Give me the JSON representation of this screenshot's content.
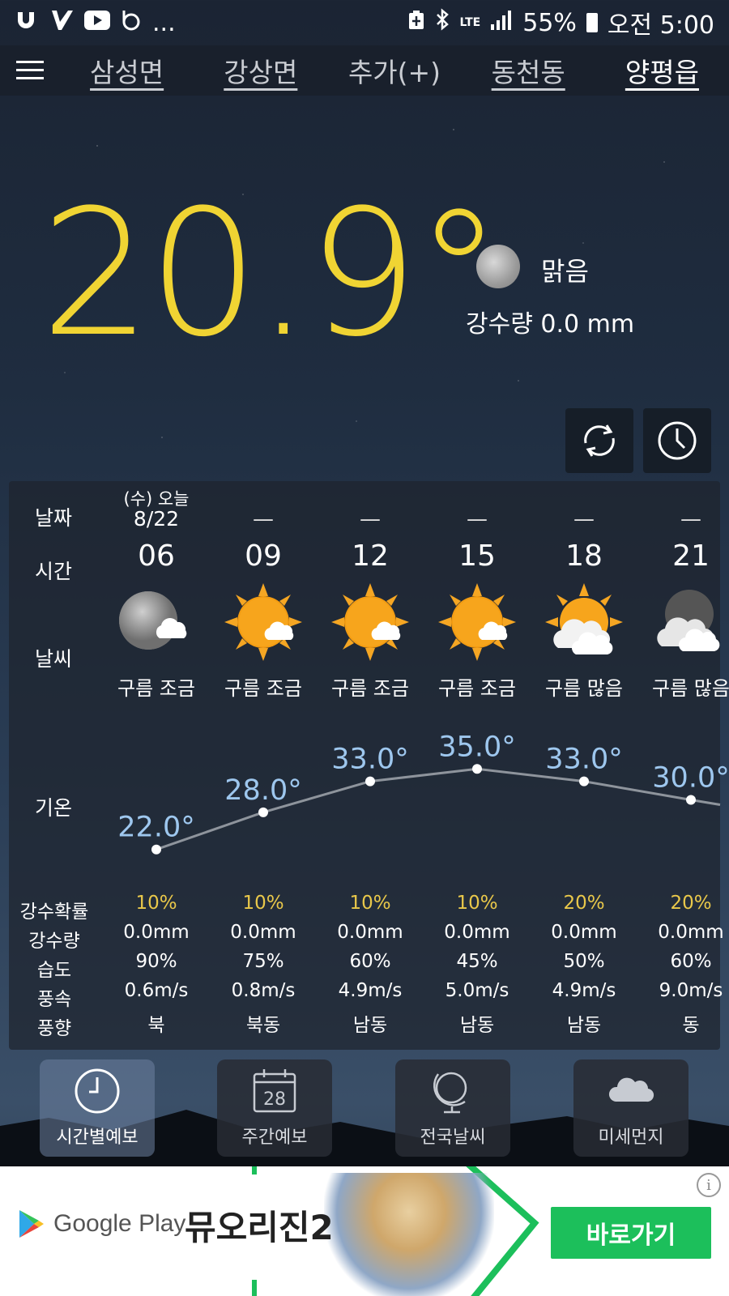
{
  "status_bar": {
    "left_icons": [
      "ubiquiti-icon",
      "vm-icon",
      "youtube-icon",
      "b-icon"
    ],
    "more": "...",
    "network": "LTE",
    "battery": "55%",
    "time": "오전 5:00"
  },
  "tabs": [
    {
      "label": "삼성면"
    },
    {
      "label": "강상면"
    },
    {
      "label": "추가(+)"
    },
    {
      "label": "동천동"
    },
    {
      "label": "양평읍"
    }
  ],
  "current": {
    "temperature": "20.9°",
    "condition": "맑음",
    "precip_label": "강수량",
    "precip_value": "0.0 mm"
  },
  "labels": {
    "date": "날짜",
    "time": "시간",
    "weather": "날씨",
    "temp": "기온",
    "precip_prob": "강수확률",
    "precip": "강수량",
    "humidity": "습도",
    "wind_speed": "풍속",
    "wind_dir": "풍향"
  },
  "forecast": [
    {
      "date_top": "(수) 오늘",
      "date_bottom": "8/22",
      "hour": "06",
      "icon": "moon-cloud-icon",
      "desc": "구름 조금",
      "temp": "22.0°",
      "temp_value": 22.0,
      "prob": "10%",
      "precip": "0.0mm",
      "humidity": "90%",
      "wind_speed": "0.6m/s",
      "wind_dir": "북"
    },
    {
      "date_top": "",
      "date_bottom": "—",
      "hour": "09",
      "icon": "sun-cloud-icon",
      "desc": "구름 조금",
      "temp": "28.0°",
      "temp_value": 28.0,
      "prob": "10%",
      "precip": "0.0mm",
      "humidity": "75%",
      "wind_speed": "0.8m/s",
      "wind_dir": "북동"
    },
    {
      "date_top": "",
      "date_bottom": "—",
      "hour": "12",
      "icon": "sun-cloud-icon",
      "desc": "구름 조금",
      "temp": "33.0°",
      "temp_value": 33.0,
      "prob": "10%",
      "precip": "0.0mm",
      "humidity": "60%",
      "wind_speed": "4.9m/s",
      "wind_dir": "남동"
    },
    {
      "date_top": "",
      "date_bottom": "—",
      "hour": "15",
      "icon": "sun-cloud-icon",
      "desc": "구름 조금",
      "temp": "35.0°",
      "temp_value": 35.0,
      "prob": "10%",
      "precip": "0.0mm",
      "humidity": "45%",
      "wind_speed": "5.0m/s",
      "wind_dir": "남동"
    },
    {
      "date_top": "",
      "date_bottom": "—",
      "hour": "18",
      "icon": "sun-clouds-icon",
      "desc": "구름 많음",
      "temp": "33.0°",
      "temp_value": 33.0,
      "prob": "20%",
      "precip": "0.0mm",
      "humidity": "50%",
      "wind_speed": "4.9m/s",
      "wind_dir": "남동"
    },
    {
      "date_top": "",
      "date_bottom": "—",
      "hour": "21",
      "icon": "moon-clouds-icon",
      "desc": "구름 많음",
      "temp": "30.0°",
      "temp_value": 30.0,
      "prob": "20%",
      "precip": "0.0mm",
      "humidity": "60%",
      "wind_speed": "9.0m/s",
      "wind_dir": "동"
    }
  ],
  "bottom_nav": [
    {
      "label": "시간별예보",
      "icon": "clock-icon",
      "active": true
    },
    {
      "label": "주간예보",
      "icon": "calendar-icon",
      "calendar_day": "28",
      "active": false
    },
    {
      "label": "전국날씨",
      "icon": "globe-icon",
      "active": false
    },
    {
      "label": "미세먼지",
      "icon": "cloud-icon",
      "active": false
    }
  ],
  "ad": {
    "store": "Google Play",
    "title": "뮤오리진2",
    "cta": "바로가기",
    "info": "i"
  },
  "colors": {
    "temp_yellow": "#f0d433",
    "temp_blue": "#9ec7ee",
    "prob_yellow": "#e9c84a",
    "ad_green": "#1cbf5b"
  }
}
